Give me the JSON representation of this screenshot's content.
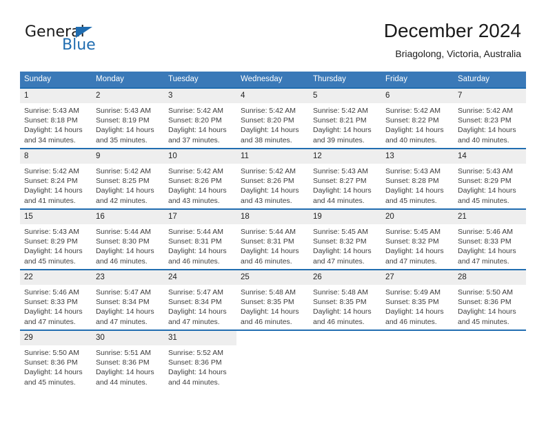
{
  "logo": {
    "word1": "General",
    "word2": "Blue",
    "accent_color": "#1f6cb0",
    "triangle_icon": "triangle-icon"
  },
  "header": {
    "title": "December 2024",
    "subtitle": "Briagolong, Victoria, Australia"
  },
  "calendar": {
    "header_bg": "#3a79b8",
    "row_border_color": "#1f6cb0",
    "daynum_bg": "#eeeeee",
    "weekday_headers": [
      "Sunday",
      "Monday",
      "Tuesday",
      "Wednesday",
      "Thursday",
      "Friday",
      "Saturday"
    ],
    "weeks": [
      [
        {
          "day": "1",
          "sunrise": "Sunrise: 5:43 AM",
          "sunset": "Sunset: 8:18 PM",
          "daylight1": "Daylight: 14 hours",
          "daylight2": "and 34 minutes."
        },
        {
          "day": "2",
          "sunrise": "Sunrise: 5:43 AM",
          "sunset": "Sunset: 8:19 PM",
          "daylight1": "Daylight: 14 hours",
          "daylight2": "and 35 minutes."
        },
        {
          "day": "3",
          "sunrise": "Sunrise: 5:42 AM",
          "sunset": "Sunset: 8:20 PM",
          "daylight1": "Daylight: 14 hours",
          "daylight2": "and 37 minutes."
        },
        {
          "day": "4",
          "sunrise": "Sunrise: 5:42 AM",
          "sunset": "Sunset: 8:20 PM",
          "daylight1": "Daylight: 14 hours",
          "daylight2": "and 38 minutes."
        },
        {
          "day": "5",
          "sunrise": "Sunrise: 5:42 AM",
          "sunset": "Sunset: 8:21 PM",
          "daylight1": "Daylight: 14 hours",
          "daylight2": "and 39 minutes."
        },
        {
          "day": "6",
          "sunrise": "Sunrise: 5:42 AM",
          "sunset": "Sunset: 8:22 PM",
          "daylight1": "Daylight: 14 hours",
          "daylight2": "and 40 minutes."
        },
        {
          "day": "7",
          "sunrise": "Sunrise: 5:42 AM",
          "sunset": "Sunset: 8:23 PM",
          "daylight1": "Daylight: 14 hours",
          "daylight2": "and 40 minutes."
        }
      ],
      [
        {
          "day": "8",
          "sunrise": "Sunrise: 5:42 AM",
          "sunset": "Sunset: 8:24 PM",
          "daylight1": "Daylight: 14 hours",
          "daylight2": "and 41 minutes."
        },
        {
          "day": "9",
          "sunrise": "Sunrise: 5:42 AM",
          "sunset": "Sunset: 8:25 PM",
          "daylight1": "Daylight: 14 hours",
          "daylight2": "and 42 minutes."
        },
        {
          "day": "10",
          "sunrise": "Sunrise: 5:42 AM",
          "sunset": "Sunset: 8:26 PM",
          "daylight1": "Daylight: 14 hours",
          "daylight2": "and 43 minutes."
        },
        {
          "day": "11",
          "sunrise": "Sunrise: 5:42 AM",
          "sunset": "Sunset: 8:26 PM",
          "daylight1": "Daylight: 14 hours",
          "daylight2": "and 43 minutes."
        },
        {
          "day": "12",
          "sunrise": "Sunrise: 5:43 AM",
          "sunset": "Sunset: 8:27 PM",
          "daylight1": "Daylight: 14 hours",
          "daylight2": "and 44 minutes."
        },
        {
          "day": "13",
          "sunrise": "Sunrise: 5:43 AM",
          "sunset": "Sunset: 8:28 PM",
          "daylight1": "Daylight: 14 hours",
          "daylight2": "and 45 minutes."
        },
        {
          "day": "14",
          "sunrise": "Sunrise: 5:43 AM",
          "sunset": "Sunset: 8:29 PM",
          "daylight1": "Daylight: 14 hours",
          "daylight2": "and 45 minutes."
        }
      ],
      [
        {
          "day": "15",
          "sunrise": "Sunrise: 5:43 AM",
          "sunset": "Sunset: 8:29 PM",
          "daylight1": "Daylight: 14 hours",
          "daylight2": "and 45 minutes."
        },
        {
          "day": "16",
          "sunrise": "Sunrise: 5:44 AM",
          "sunset": "Sunset: 8:30 PM",
          "daylight1": "Daylight: 14 hours",
          "daylight2": "and 46 minutes."
        },
        {
          "day": "17",
          "sunrise": "Sunrise: 5:44 AM",
          "sunset": "Sunset: 8:31 PM",
          "daylight1": "Daylight: 14 hours",
          "daylight2": "and 46 minutes."
        },
        {
          "day": "18",
          "sunrise": "Sunrise: 5:44 AM",
          "sunset": "Sunset: 8:31 PM",
          "daylight1": "Daylight: 14 hours",
          "daylight2": "and 46 minutes."
        },
        {
          "day": "19",
          "sunrise": "Sunrise: 5:45 AM",
          "sunset": "Sunset: 8:32 PM",
          "daylight1": "Daylight: 14 hours",
          "daylight2": "and 47 minutes."
        },
        {
          "day": "20",
          "sunrise": "Sunrise: 5:45 AM",
          "sunset": "Sunset: 8:32 PM",
          "daylight1": "Daylight: 14 hours",
          "daylight2": "and 47 minutes."
        },
        {
          "day": "21",
          "sunrise": "Sunrise: 5:46 AM",
          "sunset": "Sunset: 8:33 PM",
          "daylight1": "Daylight: 14 hours",
          "daylight2": "and 47 minutes."
        }
      ],
      [
        {
          "day": "22",
          "sunrise": "Sunrise: 5:46 AM",
          "sunset": "Sunset: 8:33 PM",
          "daylight1": "Daylight: 14 hours",
          "daylight2": "and 47 minutes."
        },
        {
          "day": "23",
          "sunrise": "Sunrise: 5:47 AM",
          "sunset": "Sunset: 8:34 PM",
          "daylight1": "Daylight: 14 hours",
          "daylight2": "and 47 minutes."
        },
        {
          "day": "24",
          "sunrise": "Sunrise: 5:47 AM",
          "sunset": "Sunset: 8:34 PM",
          "daylight1": "Daylight: 14 hours",
          "daylight2": "and 47 minutes."
        },
        {
          "day": "25",
          "sunrise": "Sunrise: 5:48 AM",
          "sunset": "Sunset: 8:35 PM",
          "daylight1": "Daylight: 14 hours",
          "daylight2": "and 46 minutes."
        },
        {
          "day": "26",
          "sunrise": "Sunrise: 5:48 AM",
          "sunset": "Sunset: 8:35 PM",
          "daylight1": "Daylight: 14 hours",
          "daylight2": "and 46 minutes."
        },
        {
          "day": "27",
          "sunrise": "Sunrise: 5:49 AM",
          "sunset": "Sunset: 8:35 PM",
          "daylight1": "Daylight: 14 hours",
          "daylight2": "and 46 minutes."
        },
        {
          "day": "28",
          "sunrise": "Sunrise: 5:50 AM",
          "sunset": "Sunset: 8:36 PM",
          "daylight1": "Daylight: 14 hours",
          "daylight2": "and 45 minutes."
        }
      ],
      [
        {
          "day": "29",
          "sunrise": "Sunrise: 5:50 AM",
          "sunset": "Sunset: 8:36 PM",
          "daylight1": "Daylight: 14 hours",
          "daylight2": "and 45 minutes."
        },
        {
          "day": "30",
          "sunrise": "Sunrise: 5:51 AM",
          "sunset": "Sunset: 8:36 PM",
          "daylight1": "Daylight: 14 hours",
          "daylight2": "and 44 minutes."
        },
        {
          "day": "31",
          "sunrise": "Sunrise: 5:52 AM",
          "sunset": "Sunset: 8:36 PM",
          "daylight1": "Daylight: 14 hours",
          "daylight2": "and 44 minutes."
        },
        {
          "day": "",
          "sunrise": "",
          "sunset": "",
          "daylight1": "",
          "daylight2": ""
        },
        {
          "day": "",
          "sunrise": "",
          "sunset": "",
          "daylight1": "",
          "daylight2": ""
        },
        {
          "day": "",
          "sunrise": "",
          "sunset": "",
          "daylight1": "",
          "daylight2": ""
        },
        {
          "day": "",
          "sunrise": "",
          "sunset": "",
          "daylight1": "",
          "daylight2": ""
        }
      ]
    ]
  }
}
